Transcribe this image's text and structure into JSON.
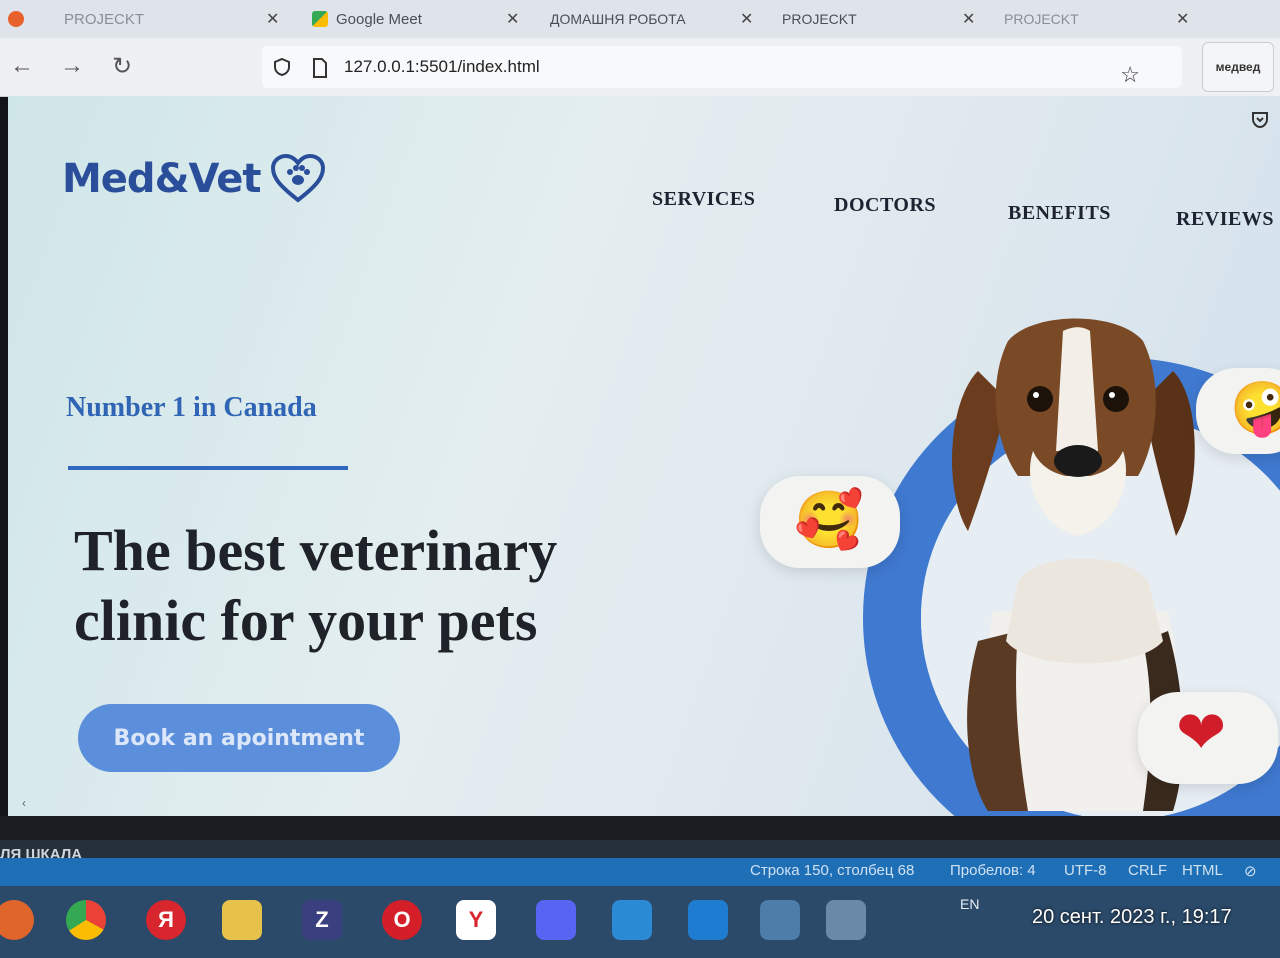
{
  "tabs": [
    {
      "label": "PROJECKT",
      "active": false
    },
    {
      "label": "Google Meet",
      "active": false
    },
    {
      "label": "ДОМАШНЯ РОБОТА",
      "active": false
    },
    {
      "label": "PROJECKT",
      "active": true
    },
    {
      "label": "PROJECKT",
      "active": false
    }
  ],
  "profile_label": "медвед",
  "address_bar": {
    "url": "127.0.0.1:5501/index.html"
  },
  "site": {
    "logo": "Med&Vet",
    "nav": [
      "SERVICES",
      "DOCTORS",
      "BENEFITS",
      "REVIEWS"
    ],
    "tagline": "Number 1 in Canada",
    "headline_line1": "The best veterinary",
    "headline_line2": "clinic for your pets",
    "cta": "Book an apointment",
    "emoji_left": "🥰",
    "emoji_right": "🤪",
    "emoji_bottom": "❤"
  },
  "editor": {
    "panel_label": "ЛЯ ШКАЛА",
    "status": {
      "position": "Строка 150, столбец 68",
      "indent": "Пробелов: 4",
      "encoding": "UTF-8",
      "eol": "CRLF",
      "language": "HTML"
    }
  },
  "taskbar": {
    "lang": "EN",
    "clock": "20 сент. 2023 г., 19:17"
  },
  "colors": {
    "brand_blue": "#2a4e9a",
    "accent_blue": "#3f79d0",
    "button_blue": "#5b8fdc"
  }
}
